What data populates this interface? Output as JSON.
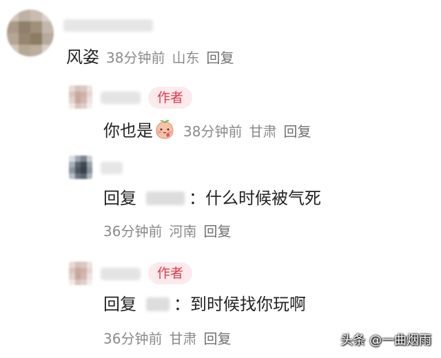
{
  "comment_top": {
    "text": "风姿",
    "time": "38分钟前",
    "location": "山东",
    "reply_label": "回复"
  },
  "reply_1": {
    "badge": "作者",
    "text": "你也是",
    "emoji_icon": "blushing-peach-face-icon",
    "time": "38分钟前",
    "location": "甘肃",
    "reply_label": "回复"
  },
  "reply_2": {
    "prefix": "回复",
    "separator": "：",
    "text": "什么时候被气死",
    "time": "36分钟前",
    "location": "河南",
    "reply_label": "回复"
  },
  "reply_3": {
    "badge": "作者",
    "prefix": "回复",
    "separator": "：",
    "text": "到时候找你玩啊",
    "time": "36分钟前",
    "location": "甘肃",
    "reply_label": "回复"
  },
  "watermark": "头条 @一曲烟雨",
  "colors": {
    "badge_text": "#e0394a",
    "badge_bg": "#fdeaec",
    "meta_text": "#8a8a8a",
    "body_text": "#222222"
  }
}
